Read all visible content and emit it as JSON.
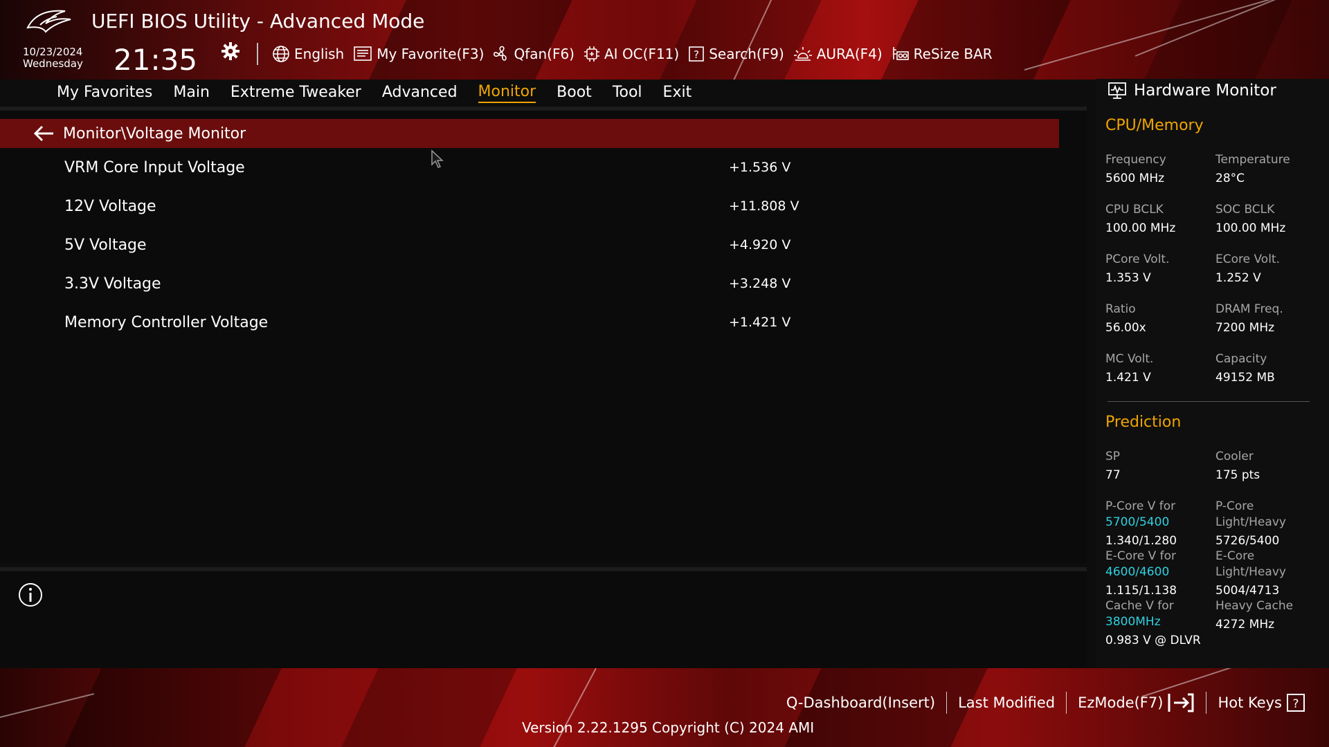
{
  "header": {
    "title": "UEFI BIOS Utility - Advanced Mode",
    "date": "10/23/2024",
    "weekday": "Wednesday",
    "time": "21:35",
    "toolbar": [
      {
        "label": "English",
        "icon": "globe-icon"
      },
      {
        "label": "My Favorite(F3)",
        "icon": "favorite-list-icon"
      },
      {
        "label": "Qfan(F6)",
        "icon": "fan-icon"
      },
      {
        "label": "AI OC(F11)",
        "icon": "ai-chip-icon"
      },
      {
        "label": "Search(F9)",
        "icon": "search-question-icon"
      },
      {
        "label": "AURA(F4)",
        "icon": "aura-light-icon"
      },
      {
        "label": "ReSize BAR",
        "icon": "resize-bar-icon"
      }
    ]
  },
  "nav": {
    "tabs": [
      "My Favorites",
      "Main",
      "Extreme Tweaker",
      "Advanced",
      "Monitor",
      "Boot",
      "Tool",
      "Exit"
    ],
    "active": "Monitor"
  },
  "main": {
    "breadcrumb": "Monitor\\Voltage Monitor",
    "rows": [
      {
        "label": "VRM Core Input Voltage",
        "value": "+1.536 V"
      },
      {
        "label": "12V Voltage",
        "value": "+11.808 V"
      },
      {
        "label": "5V Voltage",
        "value": "+4.920 V"
      },
      {
        "label": "3.3V Voltage",
        "value": "+3.248 V"
      },
      {
        "label": "Memory Controller Voltage",
        "value": "+1.421 V"
      }
    ]
  },
  "hardware_monitor": {
    "title": "Hardware Monitor",
    "cpu_memory": {
      "title": "CPU/Memory",
      "items": [
        {
          "label": "Frequency",
          "value": "5600 MHz"
        },
        {
          "label": "Temperature",
          "value": "28°C"
        },
        {
          "label": "CPU BCLK",
          "value": "100.00 MHz"
        },
        {
          "label": "SOC BCLK",
          "value": "100.00 MHz"
        },
        {
          "label": "PCore Volt.",
          "value": "1.353 V"
        },
        {
          "label": "ECore Volt.",
          "value": "1.252 V"
        },
        {
          "label": "Ratio",
          "value": "56.00x"
        },
        {
          "label": "DRAM Freq.",
          "value": "7200 MHz"
        },
        {
          "label": "MC Volt.",
          "value": "1.421 V"
        },
        {
          "label": "Capacity",
          "value": "49152 MB"
        }
      ]
    },
    "prediction": {
      "title": "Prediction",
      "sp_label": "SP",
      "sp_value": "77",
      "cooler_label": "Cooler",
      "cooler_value": "175 pts",
      "pcore_v_label": "P-Core V for",
      "pcore_v_freq": "5700/5400",
      "pcore_v_value": "1.340/1.280",
      "pcore_lh_label1": "P-Core",
      "pcore_lh_label2": "Light/Heavy",
      "pcore_lh_value": "5726/5400",
      "ecore_v_label": "E-Core V for",
      "ecore_v_freq": "4600/4600",
      "ecore_v_value": "1.115/1.138",
      "ecore_lh_label1": "E-Core",
      "ecore_lh_label2": "Light/Heavy",
      "ecore_lh_value": "5004/4713",
      "cache_v_label": "Cache V for",
      "cache_v_freq": "3800MHz",
      "cache_v_value": "0.983 V @ DLVR",
      "heavy_cache_label": "Heavy Cache",
      "heavy_cache_value": "4272 MHz"
    }
  },
  "footer": {
    "buttons": [
      "Q-Dashboard(Insert)",
      "Last Modified",
      "EzMode(F7)",
      "Hot Keys"
    ],
    "version": "Version 2.22.1295 Copyright (C) 2024 AMI"
  },
  "colors": {
    "accent": "#f0a500",
    "breadcrumb_bg": "#6b0d0d",
    "cyan": "#2fd0e0",
    "brand_red": "#8a0c0c"
  }
}
